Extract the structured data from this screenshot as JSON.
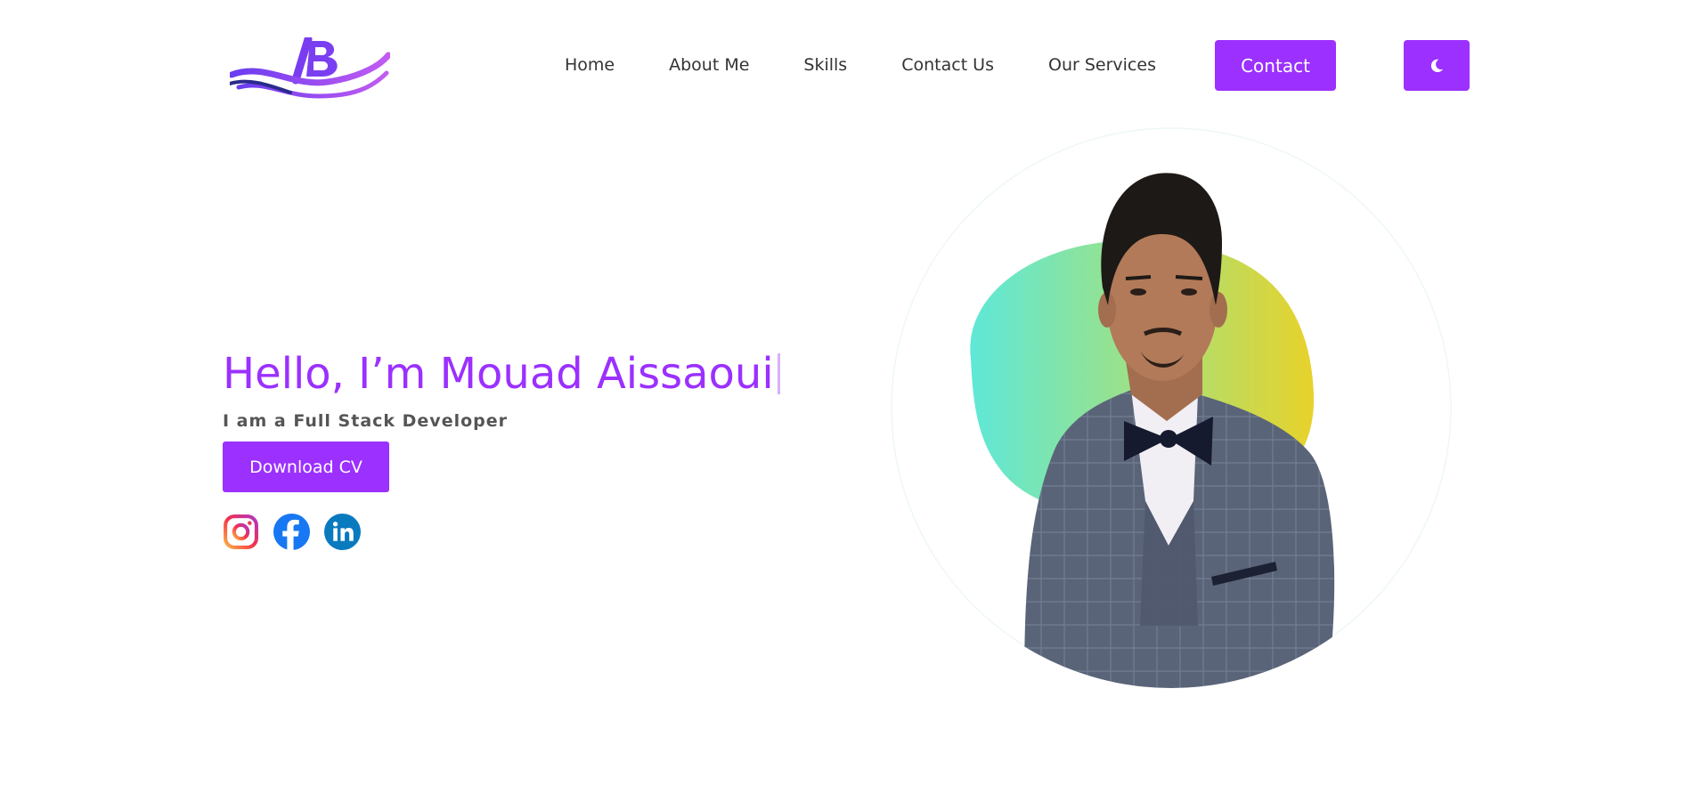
{
  "header": {
    "logo_icon": "brand-b-wave-logo",
    "nav": [
      {
        "label": "Home"
      },
      {
        "label": "About Me"
      },
      {
        "label": "Skills"
      },
      {
        "label": "Contact Us"
      },
      {
        "label": "Our Services"
      }
    ],
    "contact_label": "Contact",
    "theme_icon": "moon-icon"
  },
  "hero": {
    "title": "Hello, I’m Mouad Aissaoui",
    "subtitle": "I am a Full Stack Developer",
    "download_label": "Download CV",
    "socials": [
      "instagram-icon",
      "facebook-icon",
      "linkedin-icon"
    ]
  },
  "colors": {
    "accent": "#9b30ff",
    "blob_start": "#5ee8d8",
    "blob_end": "#e8d22a"
  }
}
